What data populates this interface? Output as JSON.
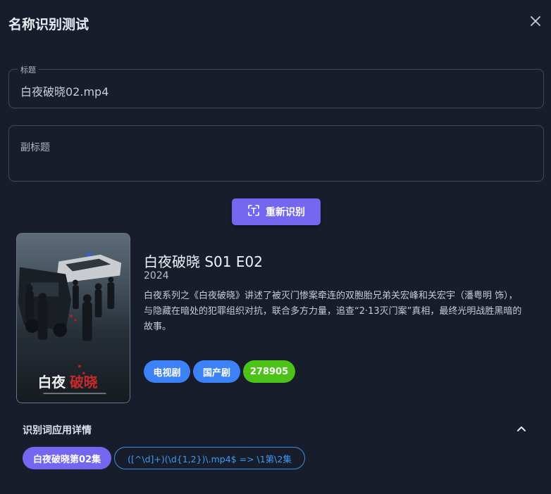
{
  "dialog": {
    "title": "名称识别测试",
    "close_icon": "close-icon"
  },
  "fields": {
    "title": {
      "label": "标题",
      "value": "白夜破晓02.mp4"
    },
    "subtitle": {
      "label": "副标题",
      "value": ""
    }
  },
  "actions": {
    "recognize_label": "重新识别",
    "recognize_icon": "text-recognition-icon"
  },
  "result": {
    "title": "白夜破晓 S01 E02",
    "year": "2024",
    "overview": "白夜系列之《白夜破晓》讲述了被灭门惨案牵连的双胞胎兄弟关宏峰和关宏宇（潘粤明 饰），与隐藏在暗处的犯罪组织对抗，联合多方力量，追查“2·13灭门案”真相，最终光明战胜黑暗的故事。",
    "poster_text": "白夜破晓",
    "tags": [
      {
        "label": "电视剧",
        "color": "#3c82f6"
      },
      {
        "label": "国产剧",
        "color": "#3c82f6"
      },
      {
        "label": "278905",
        "color": "#4dc31a"
      }
    ]
  },
  "words": {
    "section_label": "识别词应用详情",
    "collapse_icon": "chevron-up-icon",
    "applied": "白夜破晓第02集",
    "rule": "([^\\d]+)(\\d{1,2})\\.mp4$ => \\1第\\2集"
  },
  "colors": {
    "background": "#171d2b",
    "accent": "#7466ee",
    "chip_blue": "#3c82f6",
    "chip_green": "#4dc31a"
  }
}
